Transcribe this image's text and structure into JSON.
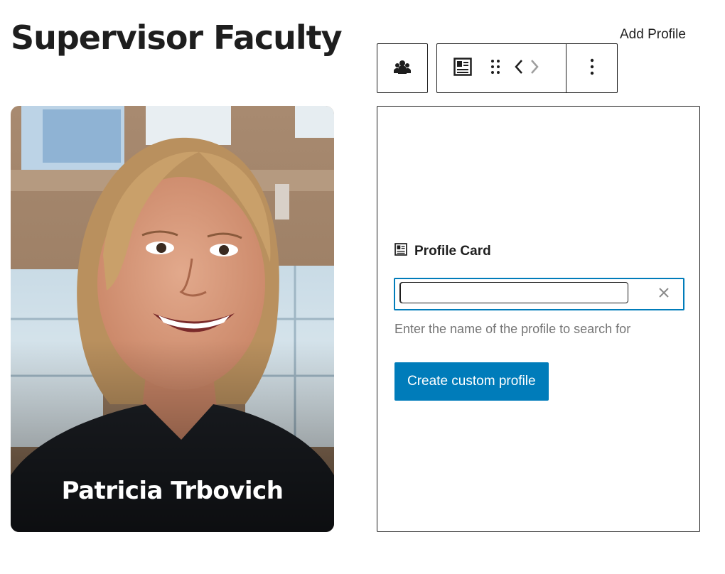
{
  "page": {
    "title": "Supervisor Faculty",
    "add_profile_label": "Add Profile"
  },
  "toolbar": {
    "parent_block_icon": "people-group-icon",
    "block_icon": "profile-card-icon",
    "drag_icon": "drag-handle-icon",
    "move_left_icon": "chevron-left-icon",
    "move_right_icon": "chevron-right-icon",
    "options_icon": "more-vertical-icon"
  },
  "profile_card": {
    "name": "Patricia Trbovich"
  },
  "search_panel": {
    "label": "Profile Card",
    "input_value": "",
    "clear_icon": "close-icon",
    "help_text": "Enter the name of the profile to search for",
    "create_button_label": "Create custom profile"
  },
  "colors": {
    "accent": "#007cba",
    "text": "#1e1e1e",
    "muted": "#757575"
  }
}
